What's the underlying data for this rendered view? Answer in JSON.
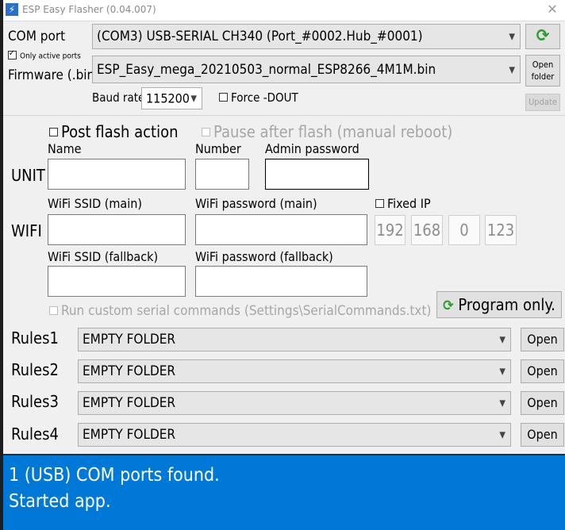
{
  "window": {
    "title": "ESP Easy Flasher (0.04.007)",
    "close_glyph": "✕"
  },
  "com": {
    "label": "COM port",
    "value": "(COM3) USB-SERIAL CH340 (Port_#0002.Hub_#0001)",
    "refresh_icon": "refresh-icon"
  },
  "only_active_ports": {
    "label": "Only active ports",
    "checked": true
  },
  "firmware": {
    "label": "Firmware (.bin)",
    "value": "ESP_Easy_mega_20210503_normal_ESP8266_4M1M.bin",
    "open_folder_label_1": "Open",
    "open_folder_label_2": "folder"
  },
  "baud": {
    "label": "Baud rate",
    "value": "115200"
  },
  "force_dout": {
    "label": "Force -DOUT",
    "checked": false
  },
  "update_button": "Update",
  "post_flash": {
    "label": "Post flash action",
    "checked": false
  },
  "pause_after_flash": {
    "label": "Pause after flash (manual reboot)",
    "checked": false,
    "disabled": true
  },
  "unit": {
    "label": "UNIT",
    "name_label": "Name",
    "name_value": "",
    "number_label": "Number",
    "number_value": "",
    "admin_label": "Admin password",
    "admin_value": ""
  },
  "wifi": {
    "label": "WIFI",
    "ssid_main_label": "WiFi SSID (main)",
    "ssid_main_value": "",
    "pass_main_label": "WiFi password (main)",
    "pass_main_value": "",
    "ssid_fb_label": "WiFi SSID (fallback)",
    "ssid_fb_value": "",
    "pass_fb_label": "WiFi password (fallback)",
    "pass_fb_value": ""
  },
  "fixed_ip": {
    "label": "Fixed IP",
    "checked": false,
    "octets": [
      "192",
      "168",
      "0",
      "123"
    ]
  },
  "custom_serial": {
    "label": "Run custom serial commands (Settings\\SerialCommands.txt)",
    "checked": false,
    "disabled": true
  },
  "program_button": "Program only.",
  "rules": [
    {
      "label": "Rules1",
      "value": "EMPTY FOLDER",
      "button": "Open"
    },
    {
      "label": "Rules2",
      "value": "EMPTY FOLDER",
      "button": "Open"
    },
    {
      "label": "Rules3",
      "value": "EMPTY FOLDER",
      "button": "Open"
    },
    {
      "label": "Rules4",
      "value": "EMPTY FOLDER",
      "button": "Open"
    }
  ],
  "log": [
    "1 (USB) COM ports found.",
    "Started app."
  ],
  "colors": {
    "log_bg": "#0078d7",
    "refresh_green": "#2a9d2a",
    "window_bg": "#f0f0f0"
  }
}
